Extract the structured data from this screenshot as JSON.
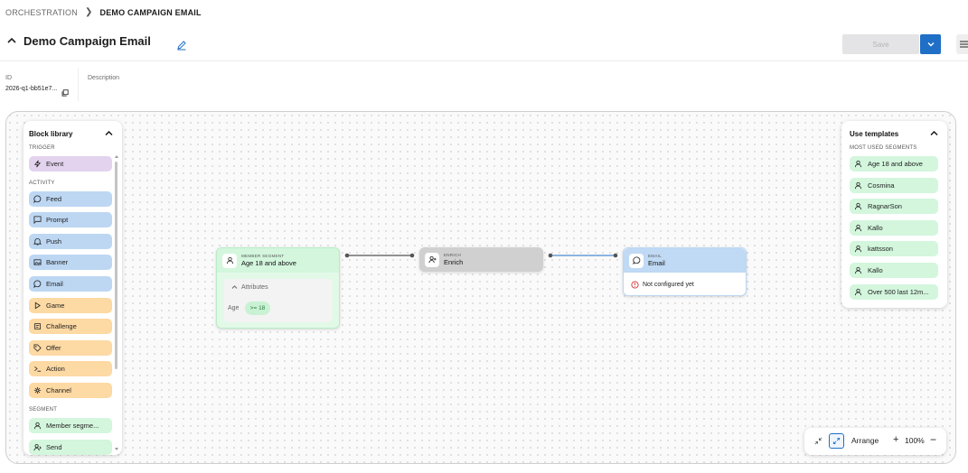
{
  "breadcrumb": {
    "root": "ORCHESTRATION",
    "current": "DEMO CAMPAIGN EMAIL"
  },
  "header": {
    "title": "Demo Campaign Email",
    "save_label": "Save"
  },
  "meta": {
    "id_label": "ID",
    "id_value": "2026-q1-bb51e7...",
    "description_label": "Description"
  },
  "block_library": {
    "title": "Block library",
    "trigger_label": "TRIGGER",
    "trigger_items": [
      {
        "label": "Event",
        "icon": "lightning-icon"
      }
    ],
    "activity_label": "ACTIVITY",
    "activity_items": [
      {
        "label": "Feed",
        "icon": "chat-bubble-icon"
      },
      {
        "label": "Prompt",
        "icon": "message-square-icon"
      },
      {
        "label": "Push",
        "icon": "bell-icon"
      },
      {
        "label": "Banner",
        "icon": "image-icon"
      },
      {
        "label": "Email",
        "icon": "chat-bubble-icon"
      },
      {
        "label": "Game",
        "icon": "play-icon"
      },
      {
        "label": "Challenge",
        "icon": "challenge-icon"
      },
      {
        "label": "Offer",
        "icon": "tag-icon"
      },
      {
        "label": "Action",
        "icon": "terminal-icon"
      },
      {
        "label": "Channel",
        "icon": "channel-icon"
      }
    ],
    "segment_label": "SEGMENT",
    "segment_items": [
      {
        "label": "Member segme...",
        "icon": "person-icon"
      },
      {
        "label": "Send",
        "icon": "send-icon"
      }
    ],
    "colors": {
      "trigger": "#e3d3ee",
      "activity": "#bdd7f3",
      "reward": "#fdd9a3",
      "segment": "#d3f6dd"
    }
  },
  "templates": {
    "title": "Use templates",
    "section_label": "MOST USED SEGMENTS",
    "items": [
      "Age 18 and above",
      "Cosmina",
      "RagnarSon",
      "Kallo",
      "kattsson",
      "Kallo",
      "Over 500 last 12m..."
    ]
  },
  "nodes": {
    "segment": {
      "type_label": "MEMBER SEGMENT",
      "name": "Age 18 and above",
      "attributes_label": "Attributes",
      "attr_key": "Age",
      "attr_value": ">= 18"
    },
    "enrich": {
      "type_label": "ENRICH",
      "name": "Enrich"
    },
    "email": {
      "type_label": "EMAIL",
      "name": "Email",
      "status": "Not configured yet"
    }
  },
  "toolbar": {
    "arrange_label": "Arrange",
    "zoom": "100%",
    "plus": "+",
    "minus": "−"
  }
}
